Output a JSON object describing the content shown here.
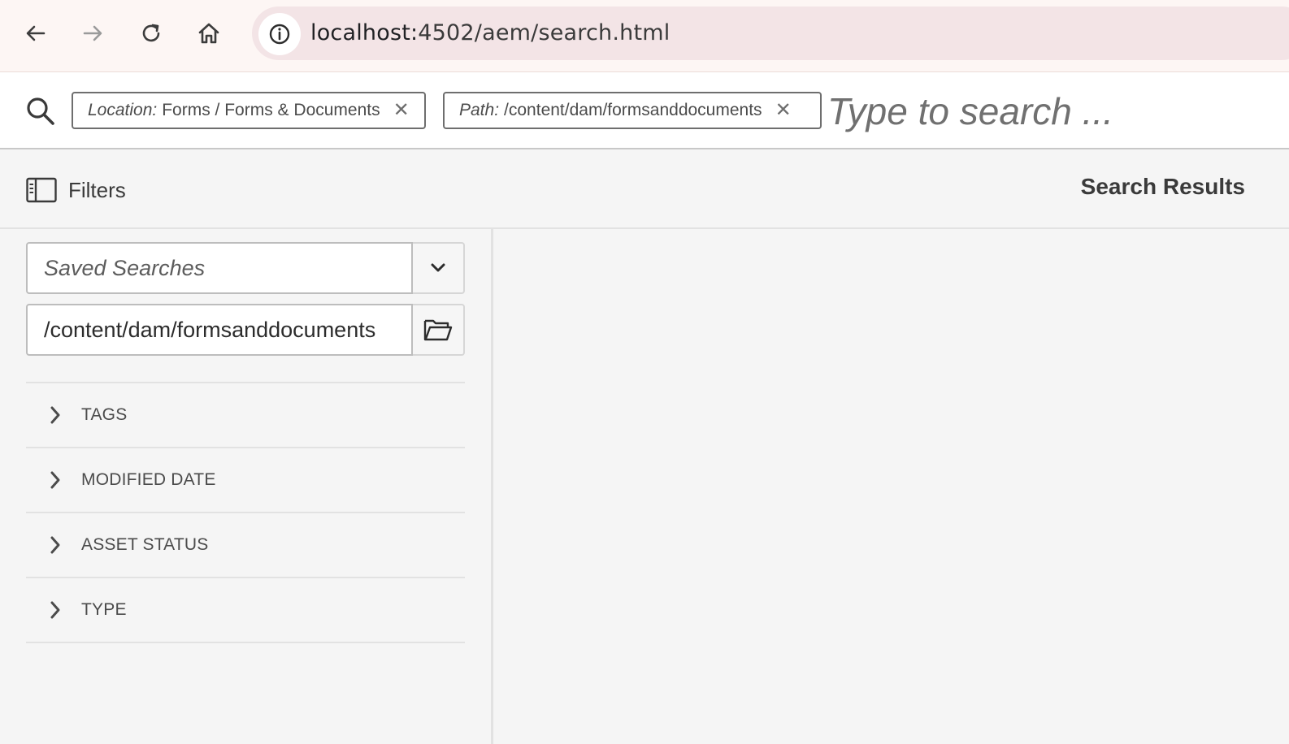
{
  "browser": {
    "url_host": "localhost:",
    "url_path": "4502/aem/search.html"
  },
  "omnisearch": {
    "tags": [
      {
        "label": "Location:",
        "value": "Forms / Forms & Documents"
      },
      {
        "label": "Path:",
        "value": "/content/dam/formsanddocuments"
      }
    ],
    "placeholder": "Type to search ..."
  },
  "toolbar": {
    "filters_label": "Filters",
    "results_title": "Search Results"
  },
  "left_rail": {
    "saved_searches_placeholder": "Saved Searches",
    "path_value": "/content/dam/formsanddocuments",
    "facets": [
      {
        "label": "TAGS"
      },
      {
        "label": "MODIFIED DATE"
      },
      {
        "label": "ASSET STATUS"
      },
      {
        "label": "TYPE"
      }
    ]
  },
  "icons": {
    "back": "arrow-left-icon",
    "forward": "arrow-right-icon",
    "reload": "reload-icon",
    "home": "home-icon",
    "site_info": "info-icon",
    "search": "search-icon",
    "remove_tag": "close-icon",
    "filters": "rail-toggle-icon",
    "dropdown": "chevron-down-icon",
    "folder": "folder-open-icon",
    "expand": "chevron-right-icon"
  }
}
